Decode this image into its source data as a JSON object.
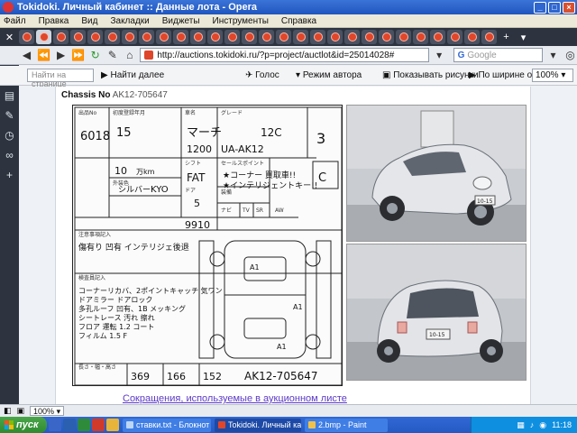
{
  "window": {
    "title": "Tokidoki. Личный кабинет :: Данные лота - Opera"
  },
  "menu": [
    "Файл",
    "Правка",
    "Вид",
    "Закладки",
    "Виджеты",
    "Инструменты",
    "Справка"
  ],
  "nav": {
    "url": "http://auctions.tokidoki.ru/?p=project/auctlot&id=25014028#",
    "search_placeholder": "Google"
  },
  "findbar": {
    "placeholder": "Найти на странице",
    "find_next": "Найти далее",
    "voice": "Голос",
    "author_mode": "Режим автора",
    "show_images": "Показывать рисунки",
    "fit_width": "По ширине окна",
    "zoom": "100%"
  },
  "lot": {
    "chassis_label": "Chassis No",
    "chassis_value": "AK12-705647",
    "abbreviations_link": "Сокращения, используемые в аукционном листе"
  },
  "sheet": {
    "lot_number": "6018",
    "year": "15",
    "model_name": "マーチ",
    "grade": "12C",
    "displacement": "1200",
    "model_code": "UA-AK12",
    "score": "3",
    "mileage": "10",
    "mileage_unit": "万km",
    "transmission": "FAT",
    "exterior_color": "シルバー",
    "color_code": "KYO",
    "doors": "5",
    "interior_score": "C",
    "mileage_km": "9910",
    "equipment_notes": "★コーナー 買取車!!\n★インテリジェントキー!!",
    "notes_line1": "傷有り 凹有 インテリジェ後退",
    "inspector_notes": "コーナーリカバ、2ポイントキャッチ 気ワン\nドアミラー ドアロック\n多孔ルーフ 凹有、1B メッキング\nシートレース 汚れ 擦れ\nフロア 運転 1.2 コート\nフィルム 1.5 F",
    "dim_length": "369",
    "dim_width": "166",
    "dim_height": "152",
    "chassis_hand": "AK12-705647",
    "plate": "10-15",
    "labels": {
      "lot": "出品No",
      "year_reg": "初度登録年月",
      "car_name": "車名",
      "grade_label": "グレード",
      "shift": "シフト",
      "color": "外装色",
      "doors_label": "ドア",
      "features": "セールスポイント",
      "equipment": "装備",
      "notes_header": "注意事項記入",
      "inspector": "検査員記入",
      "dims": "長さ・幅・高さ",
      "nav": "ナビ",
      "tv": "TV",
      "sr": "SR",
      "aw": "AW"
    }
  },
  "status": {
    "zoom": "100%"
  },
  "taskbar": {
    "start": "пуск",
    "items": [
      {
        "label": "ставки.txt - Блокнот",
        "active": false
      },
      {
        "label": "Tokidoki. Личный ка...",
        "active": true
      },
      {
        "label": "2.bmp - Paint",
        "active": false
      }
    ],
    "lang": "RU",
    "clock": "11:18"
  }
}
